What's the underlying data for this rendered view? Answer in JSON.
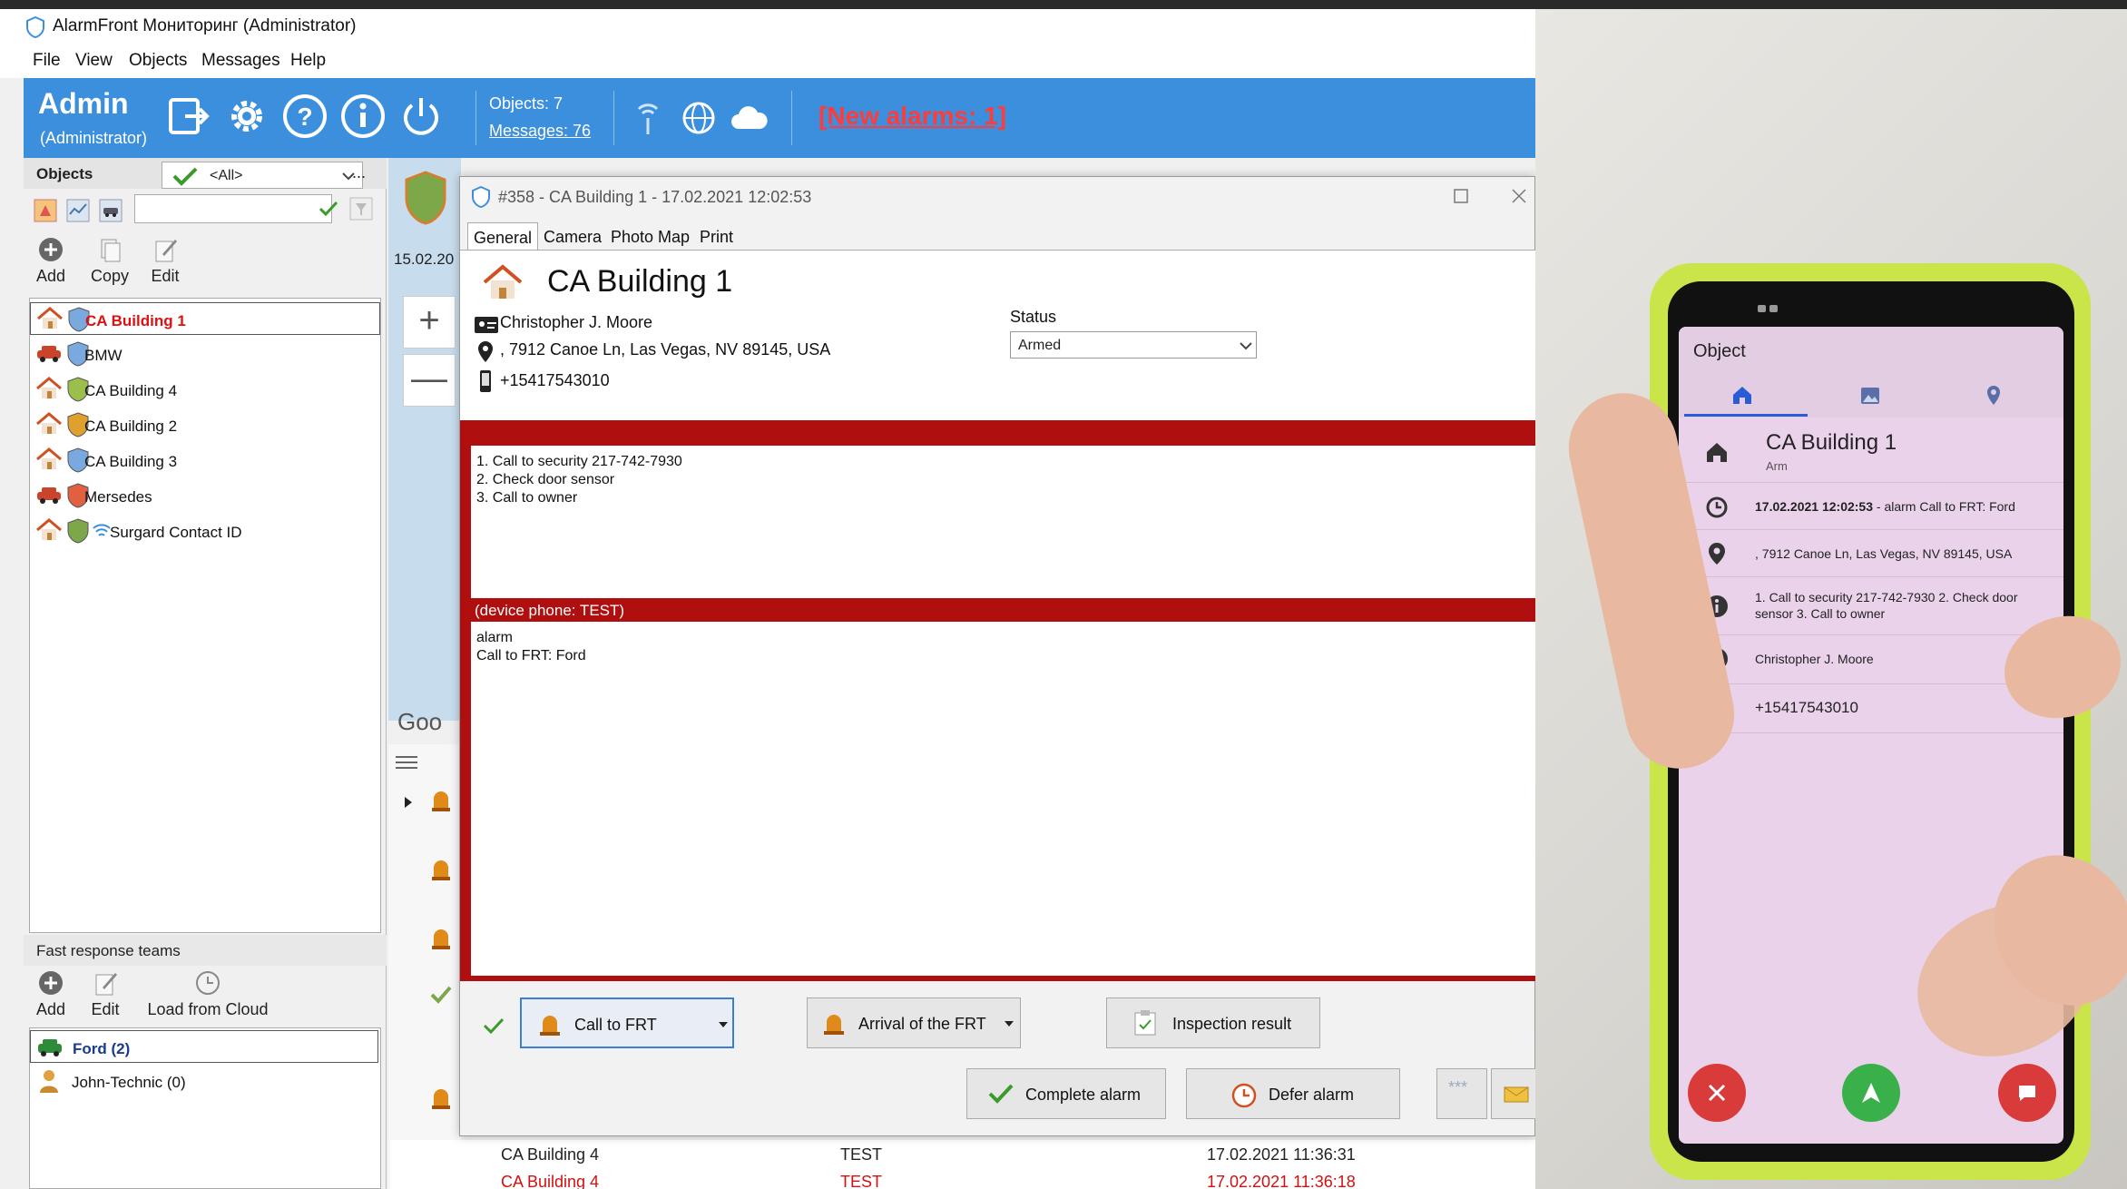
{
  "window": {
    "title": "AlarmFront Мониторинг (Administrator)"
  },
  "menu": [
    "File",
    "View",
    "Objects",
    "Messages",
    "Help"
  ],
  "toolbar": {
    "user": "Admin",
    "role": "(Administrator)",
    "objects": "Objects: 7",
    "messages": "Messages: 76",
    "new_alarms": "[New alarms: 1]"
  },
  "objects_panel": {
    "header": "Objects",
    "filter": "<All>",
    "more": "...",
    "actions": [
      "Add",
      "Copy",
      "Edit"
    ],
    "items": [
      {
        "label": "CA Building 1",
        "kind": "house",
        "selected": true
      },
      {
        "label": "BMW",
        "kind": "car",
        "selected": false
      },
      {
        "label": "CA Building 4",
        "kind": "house",
        "selected": false
      },
      {
        "label": "CA Building 2",
        "kind": "house",
        "selected": false
      },
      {
        "label": "CA Building 3",
        "kind": "house",
        "selected": false
      },
      {
        "label": "Mersedes",
        "kind": "car",
        "selected": false
      },
      {
        "label": "Surgard Contact ID",
        "kind": "house",
        "selected": false
      }
    ]
  },
  "frt_panel": {
    "header": "Fast response teams",
    "actions": [
      "Add",
      "Edit",
      "Load from Cloud"
    ],
    "items": [
      "Ford (2)",
      "John-Technic (0)"
    ]
  },
  "map": {
    "date": "15.02.20",
    "zoom_in": "+",
    "zoom_out": "—",
    "google": "Goo"
  },
  "dialog": {
    "title": "#358 - CA Building 1 - 17.02.2021 12:02:53",
    "tabs": [
      "General",
      "Camera",
      "Photo",
      "Map",
      "Print"
    ],
    "object_name": "CA Building 1",
    "contact": "Christopher J. Moore",
    "address": ",  7912 Canoe Ln, Las Vegas, NV 89145, USA",
    "phone": "+15417543010",
    "status_label": "Status",
    "status_value": "Armed",
    "instructions": [
      "1. Call to security 217-742-7930",
      "2. Check door sensor",
      "3. Call to owner"
    ],
    "device_phone": "(device phone: TEST)",
    "alarm_lines": [
      "alarm",
      "Call to FRT: Ford"
    ],
    "buttons": {
      "call_frt": "Call to FRT",
      "arrival": "Arrival of the FRT",
      "inspection": "Inspection result",
      "complete": "Complete alarm",
      "defer": "Defer alarm"
    }
  },
  "bottom_rows": [
    {
      "object": "CA Building 4",
      "source": "TEST",
      "time": "17.02.2021 11:36:31",
      "color": "#222222"
    },
    {
      "object": "CA Building 4",
      "source": "TEST",
      "time": "17.02.2021 11:36:18",
      "color": "#d11111"
    }
  ],
  "phone": {
    "header": "Object",
    "name": "CA Building 1",
    "state": "Arm",
    "alarm_time": "17.02.2021 12:02:53",
    "alarm_text": " - alarm Call to FRT: Ford",
    "address": ", 7912 Canoe Ln, Las Vegas, NV 89145, USA",
    "notes_1": "1. Call to security 217-742-7930 2. Check door",
    "notes_2": "sensor 3. Call to owner",
    "contact": "Christopher J. Moore",
    "phone": "+15417543010"
  },
  "colors": {
    "toolbar_blue": "#3b8fdc",
    "alarm_red": "#b00f0f",
    "selected_text": "#d11111",
    "phone_case": "#c9e54a",
    "phone_screen": "#ead3ea"
  }
}
